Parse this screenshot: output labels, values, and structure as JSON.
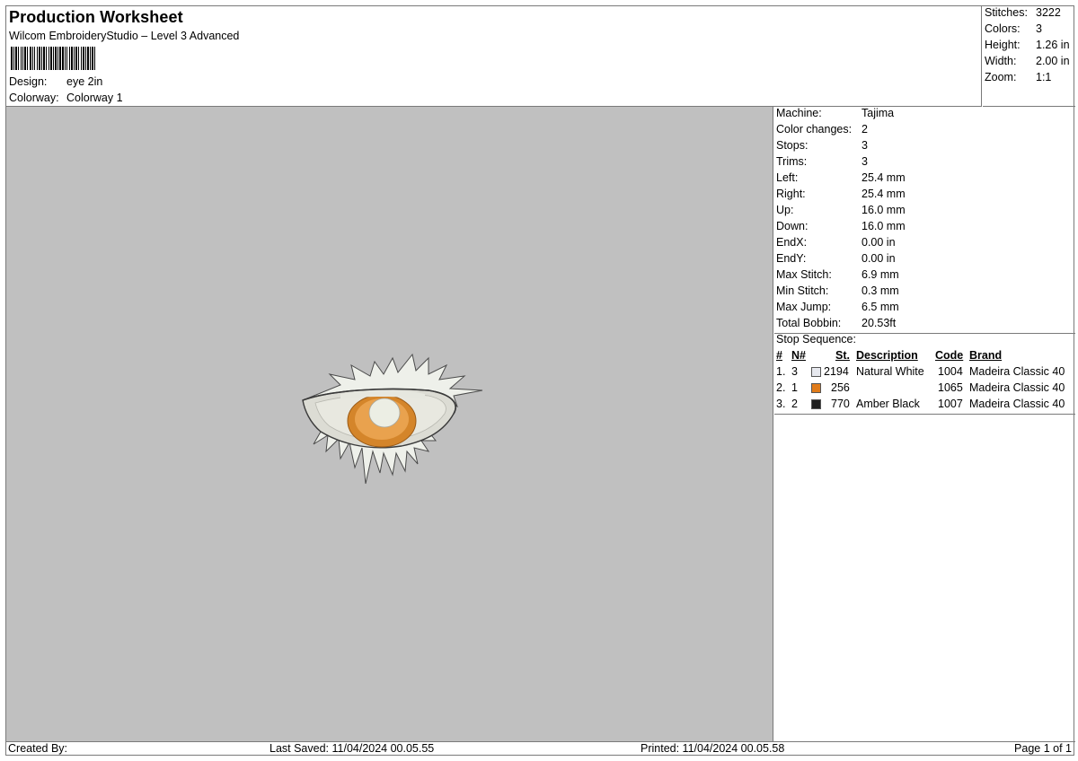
{
  "header": {
    "title": "Production Worksheet",
    "subtitle": "Wilcom EmbroideryStudio – Level 3 Advanced",
    "design_label": "Design:",
    "design_value": "eye 2in",
    "colorway_label": "Colorway:",
    "colorway_value": "Colorway 1"
  },
  "summary": {
    "stitches_label": "Stitches:",
    "stitches_value": "3222",
    "colors_label": "Colors:",
    "colors_value": "3",
    "height_label": "Height:",
    "height_value": "1.26 in",
    "width_label": "Width:",
    "width_value": "2.00 in",
    "zoom_label": "Zoom:",
    "zoom_value": "1:1"
  },
  "info": {
    "rows": [
      {
        "label": "Machine:",
        "value": "Tajima"
      },
      {
        "label": "Color changes:",
        "value": "2"
      },
      {
        "label": "Stops:",
        "value": "3"
      },
      {
        "label": "Trims:",
        "value": "3"
      },
      {
        "label": "Left:",
        "value": "25.4 mm"
      },
      {
        "label": "Right:",
        "value": "25.4 mm"
      },
      {
        "label": "Up:",
        "value": "16.0 mm"
      },
      {
        "label": "Down:",
        "value": "16.0 mm"
      },
      {
        "label": "EndX:",
        "value": "0.00 in"
      },
      {
        "label": "EndY:",
        "value": "0.00 in"
      },
      {
        "label": "Max Stitch:",
        "value": "6.9 mm"
      },
      {
        "label": "Min Stitch:",
        "value": "0.3 mm"
      },
      {
        "label": "Max Jump:",
        "value": "6.5 mm"
      },
      {
        "label": "Total Bobbin:",
        "value": "20.53ft"
      }
    ]
  },
  "stop_sequence": {
    "title": "Stop Sequence:",
    "headers": {
      "num": "#",
      "n": "N#",
      "st": "St.",
      "desc": "Description",
      "code": "Code",
      "brand": "Brand"
    },
    "rows": [
      {
        "num": "1.",
        "n": "3",
        "color": "#e6e8ee",
        "st": "2194",
        "desc": "Natural White",
        "code": "1004",
        "brand": "Madeira Classic 40"
      },
      {
        "num": "2.",
        "n": "1",
        "color": "#e07b1a",
        "st": "256",
        "desc": "",
        "code": "1065",
        "brand": "Madeira Classic 40"
      },
      {
        "num": "3.",
        "n": "2",
        "color": "#1e1e1e",
        "st": "770",
        "desc": "Amber Black",
        "code": "1007",
        "brand": "Madeira Classic 40"
      }
    ]
  },
  "footer": {
    "created_by": "Created By:",
    "last_saved": "Last Saved: 11/04/2024 00.05.55",
    "printed": "Printed: 11/04/2024 00.05.58",
    "page": "Page 1 of 1"
  },
  "colors": {
    "preview_background": "#c0c0c0",
    "border": "#7a7a7a"
  }
}
